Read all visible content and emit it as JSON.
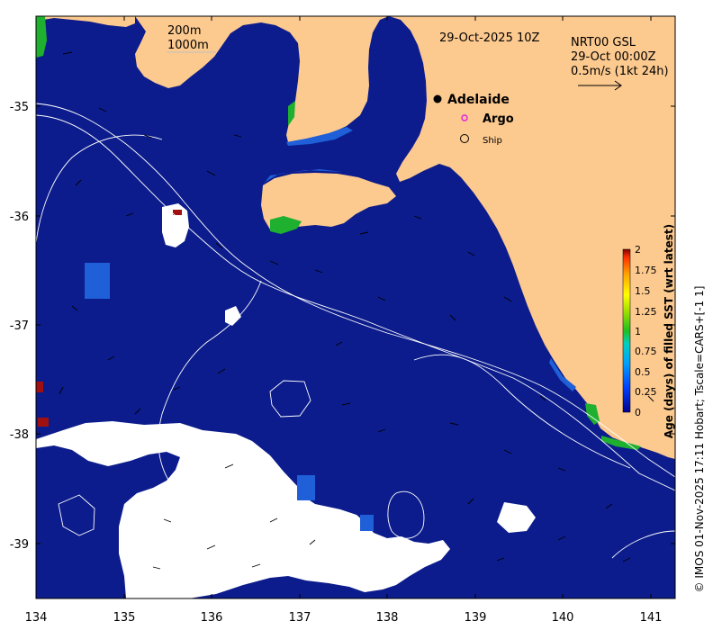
{
  "map": {
    "date_title": "29-Oct-2025 10Z",
    "contour_legend": [
      "200m",
      "1000m"
    ],
    "current_info": [
      "NRT00 GSL",
      "29-Oct 00:00Z",
      "0.5m/s (1kt 24h)"
    ],
    "place_labels": {
      "adelaide": "Adelaide",
      "argo": "Argo",
      "ship": "Ship"
    },
    "lat_ticks": [
      "-35",
      "-36",
      "-37",
      "-38",
      "-39"
    ],
    "lon_ticks": [
      "134",
      "135",
      "136",
      "137",
      "138",
      "139",
      "140",
      "141"
    ],
    "colorbar": {
      "label": "Age (days) of filled SST (wrt latest)",
      "ticks": [
        "0",
        "0.25",
        "0.5",
        "0.75",
        "1",
        "1.25",
        "1.5",
        "1.75",
        "2"
      ]
    },
    "credit": "© IMOS 01-Nov-2025 17:11 Hobart; Tscale=CARS+[-1 1]",
    "colors": {
      "ocean": "#0c1c8c",
      "land": "#fcc98f",
      "cloud": "#ffffff",
      "recent_blue": "#1f5fd8",
      "green": "#1fb030",
      "red": "#a01010"
    }
  }
}
